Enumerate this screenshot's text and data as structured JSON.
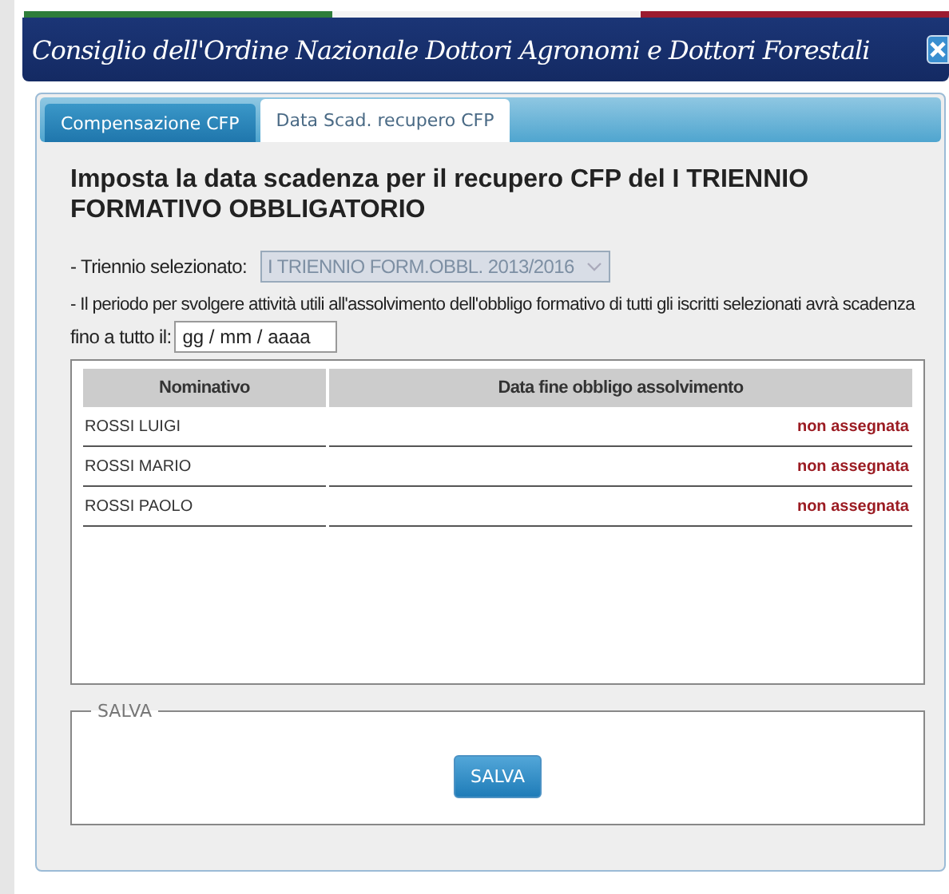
{
  "window": {
    "title": "Consiglio dell'Ordine Nazionale Dottori Agronomi e Dottori Forestali"
  },
  "tabs": [
    {
      "label": "Compensazione CFP",
      "selected": false
    },
    {
      "label": "Data Scad. recupero CFP",
      "selected": true
    }
  ],
  "heading": "Imposta la data scadenza per il recupero CFP del I TRIENNIO FORMATIVO OBBLIGATORIO",
  "triennio": {
    "label": "- Triennio selezionato:",
    "value": "I TRIENNIO FORM.OBBL. 2013/2016",
    "disabled": true
  },
  "period_text": "- Il periodo per svolgere attività utili all'assolvimento dell'obbligo formativo di tutti gli iscritti selezionati avrà scadenza",
  "date": {
    "label": "fino a tutto il:",
    "placeholder": "gg / mm / aaaa"
  },
  "table": {
    "columns": [
      "Nominativo",
      "Data fine obbligo assolvimento"
    ],
    "rows": [
      {
        "name": "ROSSI LUIGI",
        "date": "non assegnata"
      },
      {
        "name": "ROSSI MARIO",
        "date": "non assegnata"
      },
      {
        "name": "ROSSI PAOLO",
        "date": "non assegnata"
      }
    ]
  },
  "save_group": {
    "legend": "SALVA",
    "button": "SALVA"
  }
}
